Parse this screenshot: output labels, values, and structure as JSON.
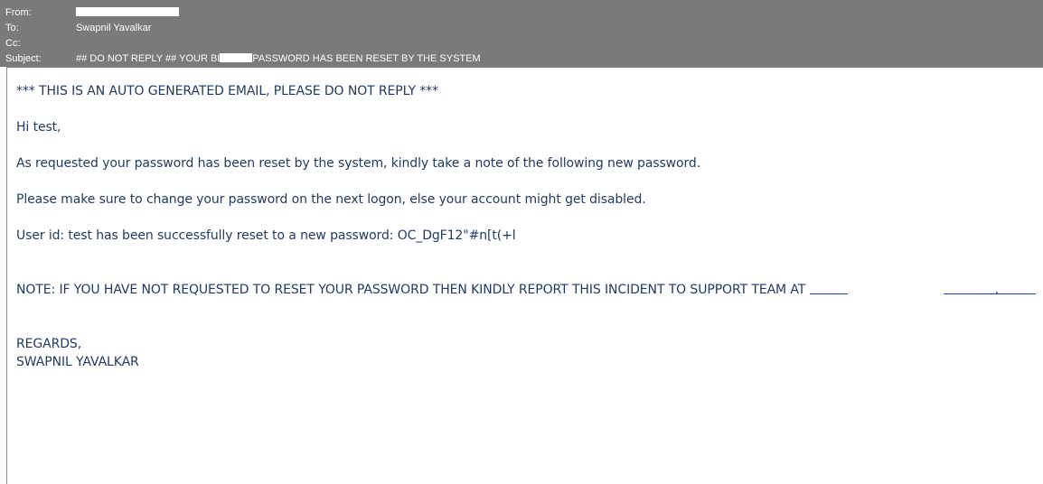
{
  "header": {
    "from_label": "From:",
    "to_label": "To:",
    "to_value": "Swapnil Yavalkar",
    "cc_label": "Cc:",
    "subject_label": "Subject:",
    "subject_prefix": "## DO NOT REPLY ## YOUR BI",
    "subject_suffix": "PASSWORD HAS BEEN RESET BY THE SYSTEM"
  },
  "message": {
    "line1": "*** THIS IS AN AUTO GENERATED EMAIL, PLEASE DO NOT REPLY ***",
    "line2": "Hi test,",
    "line3": "As requested your password has been reset by the system, kindly take a note of the following new password.",
    "line4": "Please make sure to change your password on the next logon, else your account might get disabled.",
    "line5": "User id: test has been successfully reset to a new password: OC_DgF12\"#n[t(+l",
    "note_text": "NOTE: IF YOU HAVE NOT REQUESTED TO RESET YOUR PASSWORD THEN KINDLY REPORT THIS INCIDENT TO SUPPORT TEAM AT ",
    "note_end": ".",
    "regards": "REGARDS,",
    "signature": "SWAPNIL YAVALKAR"
  },
  "colors": {
    "header_bg": "#7a7a7a",
    "body_text": "#1f3a5f",
    "link": "#1a3fb0"
  }
}
